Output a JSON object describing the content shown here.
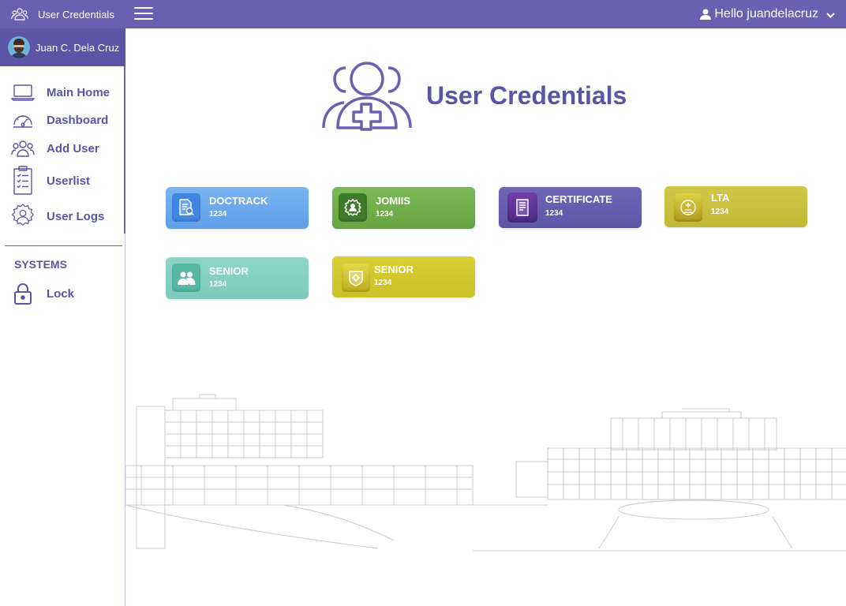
{
  "app": {
    "brand_label": "User Credentials"
  },
  "topbar": {
    "greeting": "Hello juandelacruz"
  },
  "user": {
    "name": "Juan C. Dela Cruz"
  },
  "sidebar": {
    "items": [
      {
        "label": "Main Home",
        "icon": "laptop-icon"
      },
      {
        "label": "Dashboard",
        "icon": "speedometer-icon"
      },
      {
        "label": "Add User",
        "icon": "users-icon"
      },
      {
        "label": "Userlist",
        "icon": "clipboard-list-icon"
      },
      {
        "label": "User Logs",
        "icon": "user-gear-icon"
      }
    ],
    "section_title": "SYSTEMS",
    "section_items": [
      {
        "label": "Lock",
        "icon": "lock-icon"
      }
    ]
  },
  "page": {
    "title": "User Credentials"
  },
  "cards": [
    {
      "name": "DOCTRACK",
      "value": "1234",
      "color": "#6aa8ee",
      "icon": "document-search-icon"
    },
    {
      "name": "JOMIIS",
      "value": "1234",
      "color": "#6fae4b",
      "icon": "gear-person-icon"
    },
    {
      "name": "CERTIFICATE",
      "value": "1234",
      "color": "#6a5fb0",
      "icon": "certificate-icon"
    },
    {
      "name": "LTA",
      "value": "1234",
      "color": "#c9bf3d",
      "icon": "fingerprint-icon"
    },
    {
      "name": "SENIOR",
      "value": "1234",
      "color": "#85cfc0",
      "icon": "people-icon"
    },
    {
      "name": "SENIOR",
      "value": "1234",
      "color": "#d2c82c",
      "icon": "badge-icon"
    }
  ]
}
